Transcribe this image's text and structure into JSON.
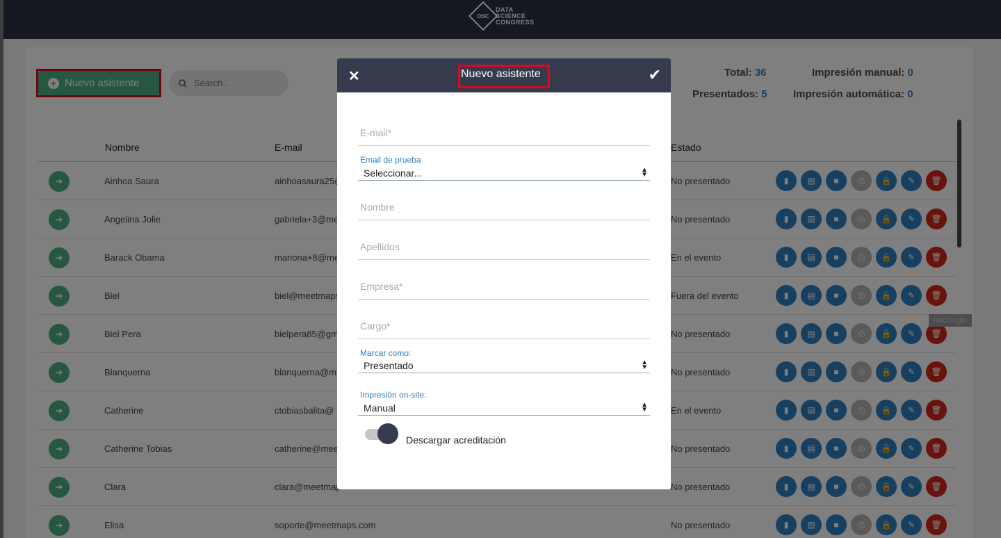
{
  "brand": {
    "mark": "DSC",
    "line1": "DATA",
    "line2": "SCIENCE",
    "line3": "CONGRESS"
  },
  "toolbar": {
    "new_label": "Nuevo asistente",
    "search_placeholder": "Search.."
  },
  "stats": {
    "total_label": "Total:",
    "total": "36",
    "presentados_label": "Presentados:",
    "presentados": "5",
    "manual_label": "Impresión manual:",
    "manual": "0",
    "auto_label": "Impresión automática:",
    "auto": "0"
  },
  "table": {
    "headers": [
      "Nombre",
      "E-mail",
      "Estado"
    ],
    "rows": [
      {
        "name": "Ainhoa Saura",
        "email": "ainhoasaura25@",
        "status": "No presentado"
      },
      {
        "name": "Angelina Jolie",
        "email": "gabriela+3@me",
        "status": "No presentado"
      },
      {
        "name": "Barack Obama",
        "email": "mariona+8@me",
        "status": "En el evento"
      },
      {
        "name": "Biel",
        "email": "biel@meetmaps",
        "status": "Fuera del evento"
      },
      {
        "name": "Biel Pera",
        "email": "bielpera85@gm",
        "status": "No presentado"
      },
      {
        "name": "Blanquerna",
        "email": "blanquerna@m",
        "status": "No presentado"
      },
      {
        "name": "Catherine",
        "email": "ctobiasbalita@",
        "status": "En el evento"
      },
      {
        "name": "Catherine Tobias",
        "email": "catherine@mee",
        "status": "No presentado"
      },
      {
        "name": "Clara",
        "email": "clara@meetmap",
        "status": "No presentado"
      },
      {
        "name": "Elisa",
        "email": "soporte@meetmaps.com",
        "status": "No presentado"
      }
    ]
  },
  "tooltip": "Rectangle",
  "modal": {
    "title": "Nuevo asistente",
    "email_placeholder": "E-mail*",
    "test_email_label": "Email de prueba",
    "test_email_value": "Seleccionar...",
    "nombre_placeholder": "Nombre",
    "apellidos_placeholder": "Apellidos",
    "empresa_placeholder": "Empresa*",
    "cargo_placeholder": "Cargo*",
    "marcar_label": "Marcar como:",
    "marcar_value": "Presentado",
    "impresion_label": "Impresión on-site:",
    "impresion_value": "Manual",
    "toggle_label": "Descargar acreditación",
    "toggle_on": true
  },
  "colors": {
    "accent": "#2f7fc1",
    "green": "#4caf80",
    "red": "#d0261b",
    "header": "#353b4d"
  }
}
